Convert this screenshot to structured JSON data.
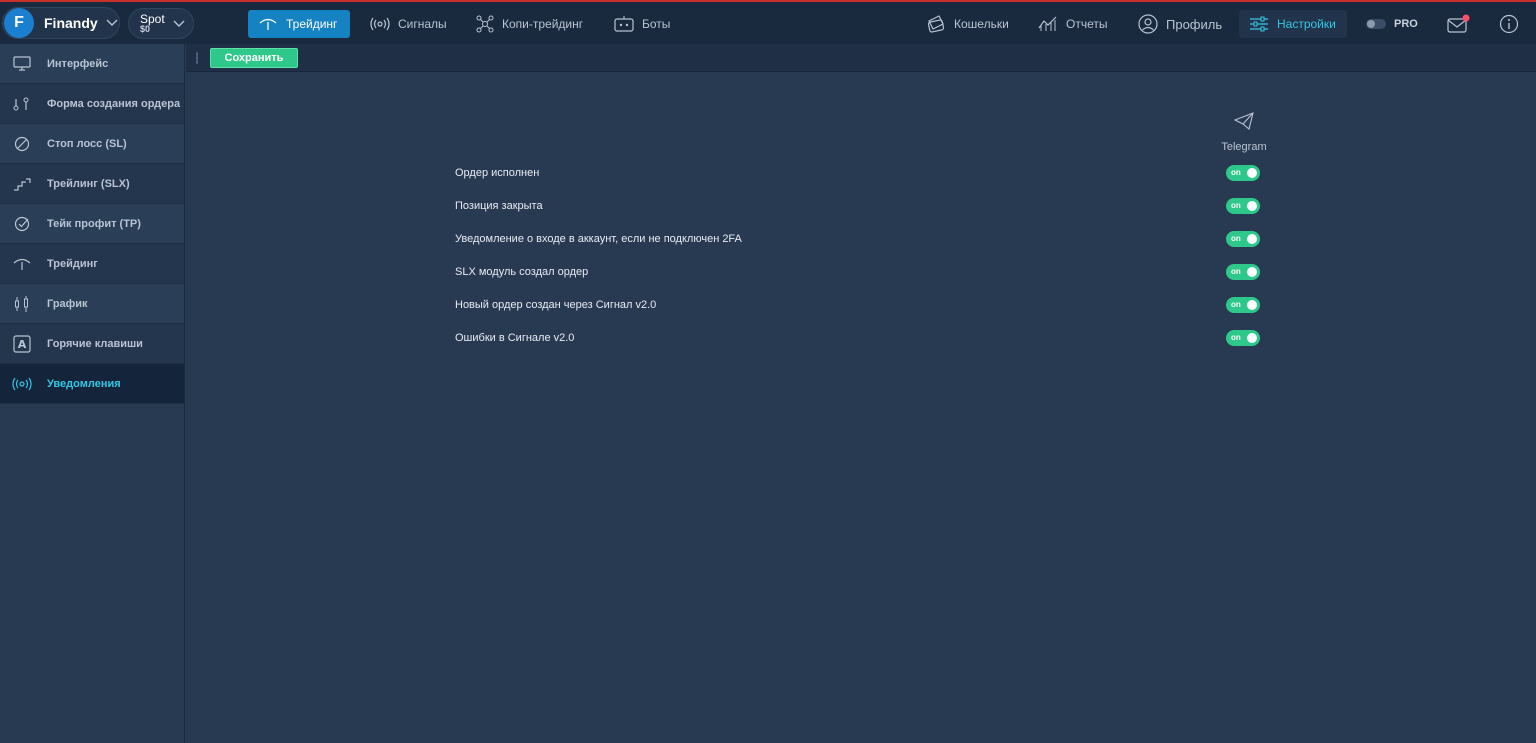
{
  "brand": {
    "logo_letter": "F",
    "name": "Finandy"
  },
  "market": {
    "name": "Spot",
    "balance": "$0"
  },
  "nav": {
    "trading": "Трейдинг",
    "signals": "Сигналы",
    "copy_trading": "Копи-трейдинг",
    "bots": "Боты",
    "wallets": "Кошельки",
    "reports": "Отчеты",
    "profile": "Профиль",
    "settings": "Настройки",
    "pro": "PRO"
  },
  "toolbar": {
    "save_label": "Сохранить"
  },
  "sidebar": {
    "items": [
      {
        "label": "Интерфейс",
        "icon": "monitor-icon"
      },
      {
        "label": "Форма создания ордера",
        "icon": "order-form-icon"
      },
      {
        "label": "Стоп лосс (SL)",
        "icon": "stop-icon"
      },
      {
        "label": "Трейлинг (SLX)",
        "icon": "trailing-icon"
      },
      {
        "label": "Тейк профит (TP)",
        "icon": "check-circle-icon"
      },
      {
        "label": "Трейдинг",
        "icon": "trading-icon"
      },
      {
        "label": "График",
        "icon": "candles-icon"
      },
      {
        "label": "Горячие клавиши",
        "icon": "keyboard-icon"
      },
      {
        "label": "Уведомления",
        "icon": "broadcast-icon"
      }
    ],
    "active_index": 8
  },
  "notifications": {
    "channel": "Telegram",
    "rows": [
      {
        "label": "Ордер исполнен",
        "state": "on"
      },
      {
        "label": "Позиция закрыта",
        "state": "on"
      },
      {
        "label": "Уведомление о входе в аккаунт, если не подключен 2FA",
        "state": "on"
      },
      {
        "label": "SLX модуль создал ордер",
        "state": "on"
      },
      {
        "label": "Новый ордер создан через Сигнал v2.0",
        "state": "on"
      },
      {
        "label": "Ошибки в Сигнале v2.0",
        "state": "on"
      }
    ]
  },
  "colors": {
    "accent": "#35c6e6",
    "active_nav": "#1582c2",
    "switch_on": "#2ec98a",
    "mail_badge": "#ff4d6a"
  }
}
